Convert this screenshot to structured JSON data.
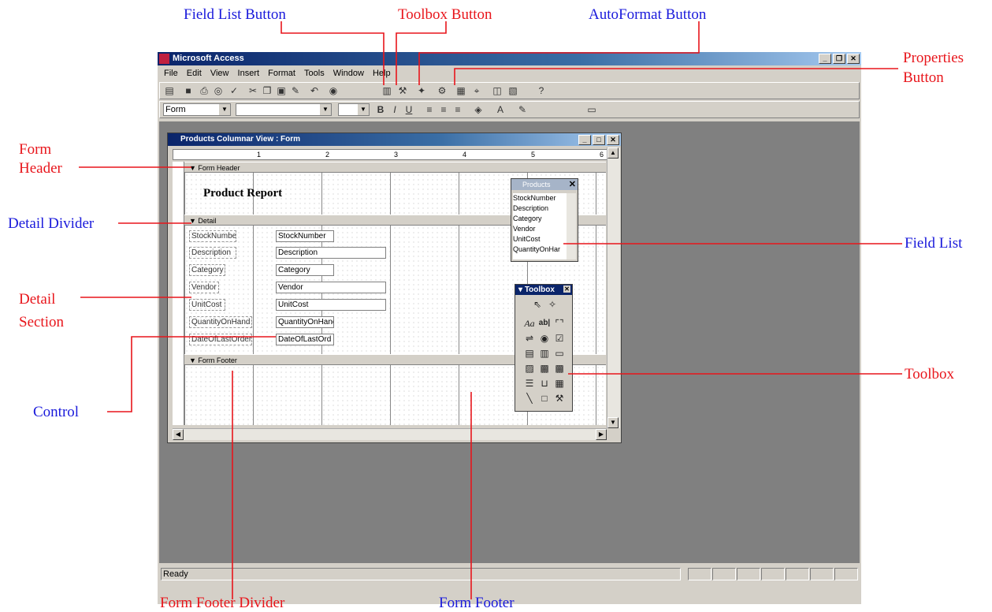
{
  "callouts": {
    "field_list_button": "Field List Button",
    "toolbox_button": "Toolbox Button",
    "autoformat_button": "AutoFormat Button",
    "properties_line1": "Properties",
    "properties_line2": "Button",
    "form_header_line1": "Form",
    "form_header_line2": "Header",
    "detail_divider": "Detail Divider",
    "field_list": "Field List",
    "detail_section_line1": "Detail",
    "detail_section_line2": "Section",
    "toolbox": "Toolbox",
    "control": "Control",
    "form_footer_divider": "Form Footer Divider",
    "form_footer": "Form Footer"
  },
  "app": {
    "title": "Microsoft Access",
    "menu": [
      "File",
      "Edit",
      "View",
      "Insert",
      "Format",
      "Tools",
      "Window",
      "Help"
    ],
    "object_selector": "Form",
    "status": "Ready"
  },
  "form_window": {
    "title": "Products Columnar View : Form",
    "sections": {
      "header": "Form Header",
      "detail": "Detail",
      "footer": "Form Footer"
    },
    "header_label": "Product Report",
    "controls": [
      {
        "label": "StockNumber",
        "field": "StockNumber"
      },
      {
        "label": "Description",
        "field": "Description"
      },
      {
        "label": "Category",
        "field": "Category"
      },
      {
        "label": "Vendor",
        "field": "Vendor"
      },
      {
        "label": "UnitCost",
        "field": "UnitCost"
      },
      {
        "label": "QuantityOnHand",
        "field": "QuantityOnHanc"
      },
      {
        "label": "DateOfLastOrder",
        "field": "DateOfLastOrd"
      }
    ],
    "ruler_numbers": [
      "1",
      "2",
      "3",
      "4",
      "5",
      "6"
    ]
  },
  "field_list": {
    "title": "Products",
    "items": [
      "StockNumber",
      "Description",
      "Category",
      "Vendor",
      "UnitCost",
      "QuantityOnHar"
    ]
  },
  "toolbox": {
    "title": "Toolbox"
  },
  "colors": {
    "callout_red": "#e8151b",
    "callout_blue": "#1a1adb",
    "line": "#e8151b"
  }
}
